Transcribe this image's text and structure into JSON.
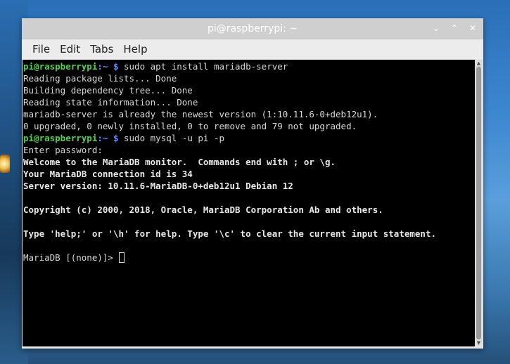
{
  "window": {
    "title": "pi@raspberrypi: ~",
    "controls": {
      "minimize": "⌄",
      "maximize": "⌃",
      "close": "✕"
    }
  },
  "menu": {
    "file": "File",
    "edit": "Edit",
    "tabs": "Tabs",
    "help": "Help"
  },
  "terminal": {
    "prompt_user": "pi@raspberrypi",
    "prompt_path": ":~",
    "prompt_dollar": " $",
    "cmd1": " sudo apt install mariadb-server",
    "out1": "Reading package lists... Done",
    "out2": "Building dependency tree... Done",
    "out3": "Reading state information... Done",
    "out4": "mariadb-server is already the newest version (1:10.11.6-0+deb12u1).",
    "out5": "0 upgraded, 0 newly installed, 0 to remove and 79 not upgraded.",
    "cmd2": " sudo mysql -u pi -p",
    "out6": "Enter password:",
    "out7": "Welcome to the MariaDB monitor.  Commands end with ; or \\g.",
    "out8": "Your MariaDB connection id is 34",
    "out9": "Server version: 10.11.6-MariaDB-0+deb12u1 Debian 12",
    "out10": "Copyright (c) 2000, 2018, Oracle, MariaDB Corporation Ab and others.",
    "out11": "Type 'help;' or '\\h' for help. Type '\\c' to clear the current input statement.",
    "mariadb_prompt": "MariaDB [(none)]> "
  },
  "colors": {
    "prompt_user": "#4ed24e",
    "prompt_path": "#6b8cff",
    "terminal_bg": "#000000"
  }
}
